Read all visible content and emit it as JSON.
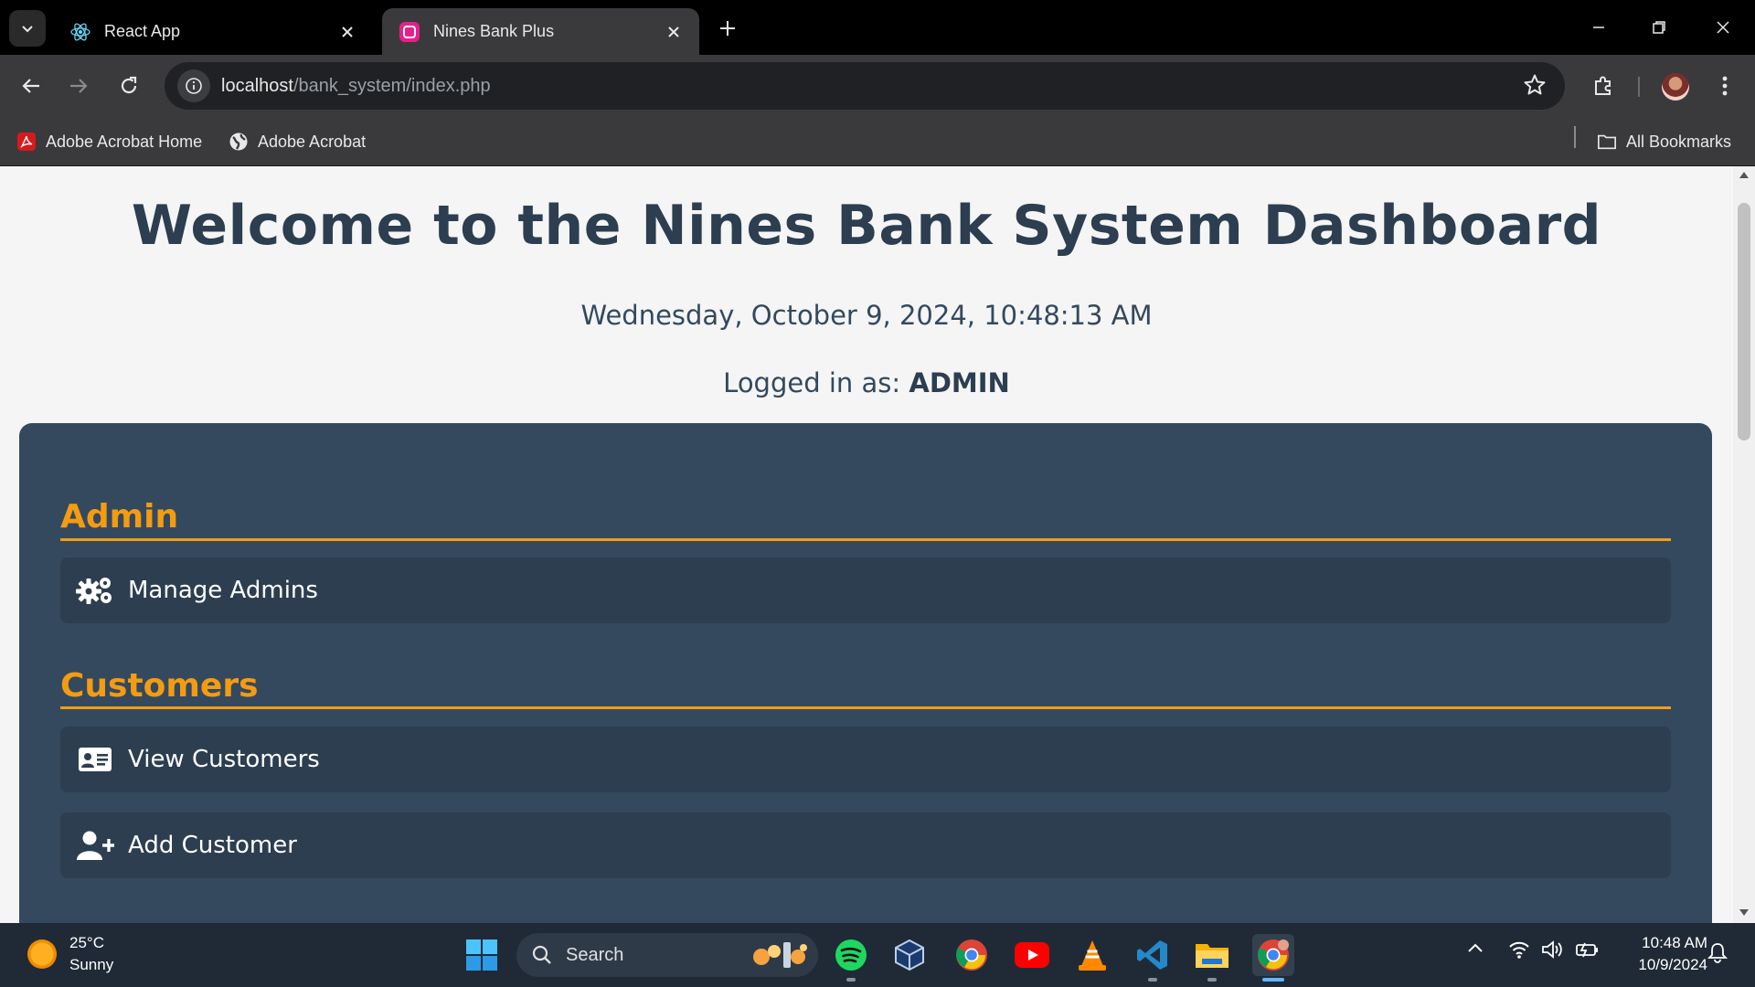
{
  "browser": {
    "tabs": [
      {
        "title": "React App",
        "active": false,
        "icon": "react-icon"
      },
      {
        "title": "Nines Bank Plus",
        "active": true,
        "icon": "bank-favicon-icon"
      }
    ],
    "url_host": "localhost",
    "url_path": "/bank_system/index.php",
    "bookmarks": [
      {
        "label": "Adobe Acrobat Home",
        "icon": "adobe-acrobat-icon"
      },
      {
        "label": "Adobe Acrobat",
        "icon": "globe-icon"
      }
    ],
    "all_bookmarks_label": "All Bookmarks"
  },
  "page": {
    "title": "Welcome to the Nines Bank System Dashboard",
    "datetime": "Wednesday, October 9, 2024, 10:48:13 AM",
    "logged_in_prefix": "Logged in as:",
    "logged_in_user": "ADMIN",
    "sections": [
      {
        "title": "Admin",
        "items": [
          {
            "label": "Manage Admins",
            "icon": "gears-icon"
          }
        ]
      },
      {
        "title": "Customers",
        "items": [
          {
            "label": "View Customers",
            "icon": "id-card-icon"
          },
          {
            "label": "Add Customer",
            "icon": "user-plus-icon"
          }
        ]
      }
    ],
    "colors": {
      "heading": "#2c3e50",
      "panel": "#34495e",
      "accent": "#f39c12",
      "card": "#2c3e50"
    }
  },
  "taskbar": {
    "weather_temp": "25°C",
    "weather_desc": "Sunny",
    "search_placeholder": "Search",
    "time": "10:48 AM",
    "date": "10/9/2024",
    "pinned": [
      "windows-start-icon",
      "spotify-icon",
      "virtualbox-icon",
      "chrome-icon",
      "youtube-icon",
      "vlc-icon",
      "vscode-icon",
      "file-explorer-icon",
      "chrome-canary-icon"
    ]
  }
}
